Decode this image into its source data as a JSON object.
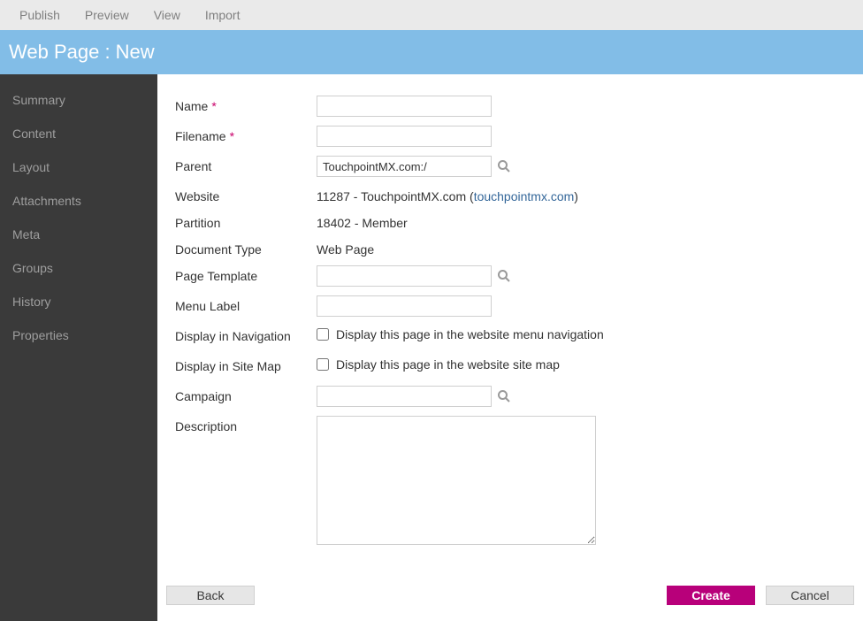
{
  "topmenu": {
    "publish": "Publish",
    "preview": "Preview",
    "view": "View",
    "import": "Import"
  },
  "page_title": "Web Page : New",
  "sidebar": {
    "items": [
      {
        "label": "Summary"
      },
      {
        "label": "Content"
      },
      {
        "label": "Layout"
      },
      {
        "label": "Attachments"
      },
      {
        "label": "Meta"
      },
      {
        "label": "Groups"
      },
      {
        "label": "History"
      },
      {
        "label": "Properties"
      }
    ]
  },
  "form": {
    "name_label": "Name",
    "name_value": "",
    "filename_label": "Filename",
    "filename_value": "",
    "parent_label": "Parent",
    "parent_value": "TouchpointMX.com:/",
    "website_label": "Website",
    "website_value": "11287 - TouchpointMX.com  (",
    "website_link": "touchpointmx.com",
    "website_value_close": ")",
    "partition_label": "Partition",
    "partition_value": "18402 - Member",
    "doctype_label": "Document Type",
    "doctype_value": "Web Page",
    "pagetemplate_label": "Page Template",
    "pagetemplate_value": "",
    "menulabel_label": "Menu Label",
    "menulabel_value": "",
    "displaynav_label": "Display in Navigation",
    "displaynav_cb_label": "Display this page in the website menu navigation",
    "displaysm_label": "Display in Site Map",
    "displaysm_cb_label": "Display this page in the website site map",
    "campaign_label": "Campaign",
    "campaign_value": "",
    "description_label": "Description",
    "description_value": ""
  },
  "buttons": {
    "back": "Back",
    "create": "Create",
    "cancel": "Cancel"
  }
}
